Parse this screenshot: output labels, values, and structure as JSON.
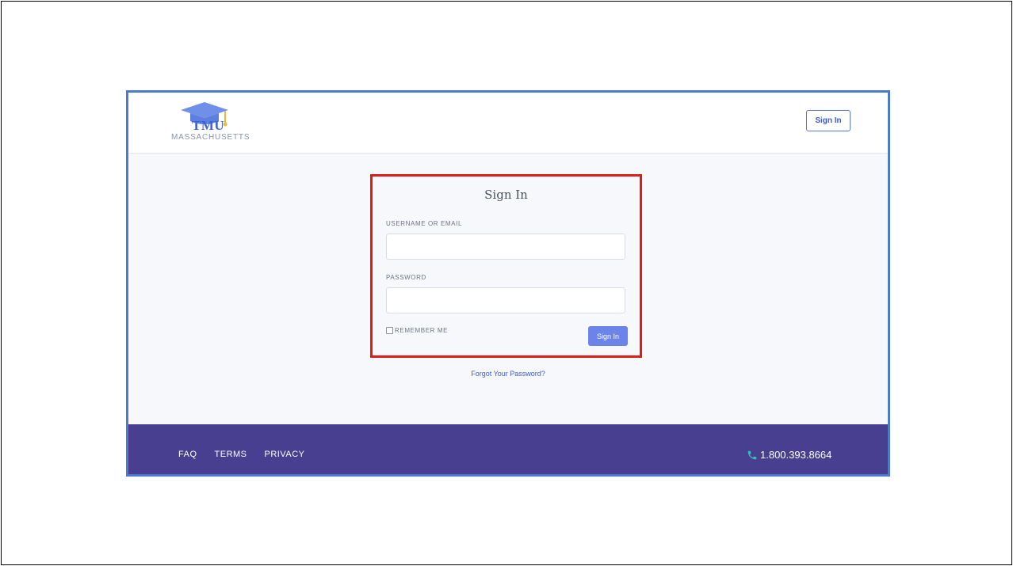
{
  "header": {
    "logo_text": "TMU",
    "logo_subtitle": "MASSACHUSETTS",
    "signin_label": "Sign In"
  },
  "form": {
    "title": "Sign In",
    "username_label": "USERNAME OR EMAIL",
    "username_value": "",
    "password_label": "PASSWORD",
    "password_value": "",
    "remember_label": "REMEMBER ME",
    "remember_checked": false,
    "submit_label": "Sign In"
  },
  "forgot_password": "Forgot Your Password?",
  "footer": {
    "links": [
      "FAQ",
      "TERMS",
      "PRIVACY"
    ],
    "phone": "1.800.393.8664"
  },
  "colors": {
    "brand_blue": "#3d5ad8",
    "button_blue": "#6c84ea",
    "footer_purple": "#483f91",
    "highlight_red": "#e11a1a",
    "frame_blue": "#4a7bd0",
    "phone_icon": "#2ec4b6"
  },
  "icons": {
    "logo": "graduation-cap-icon",
    "phone": "phone-icon"
  }
}
